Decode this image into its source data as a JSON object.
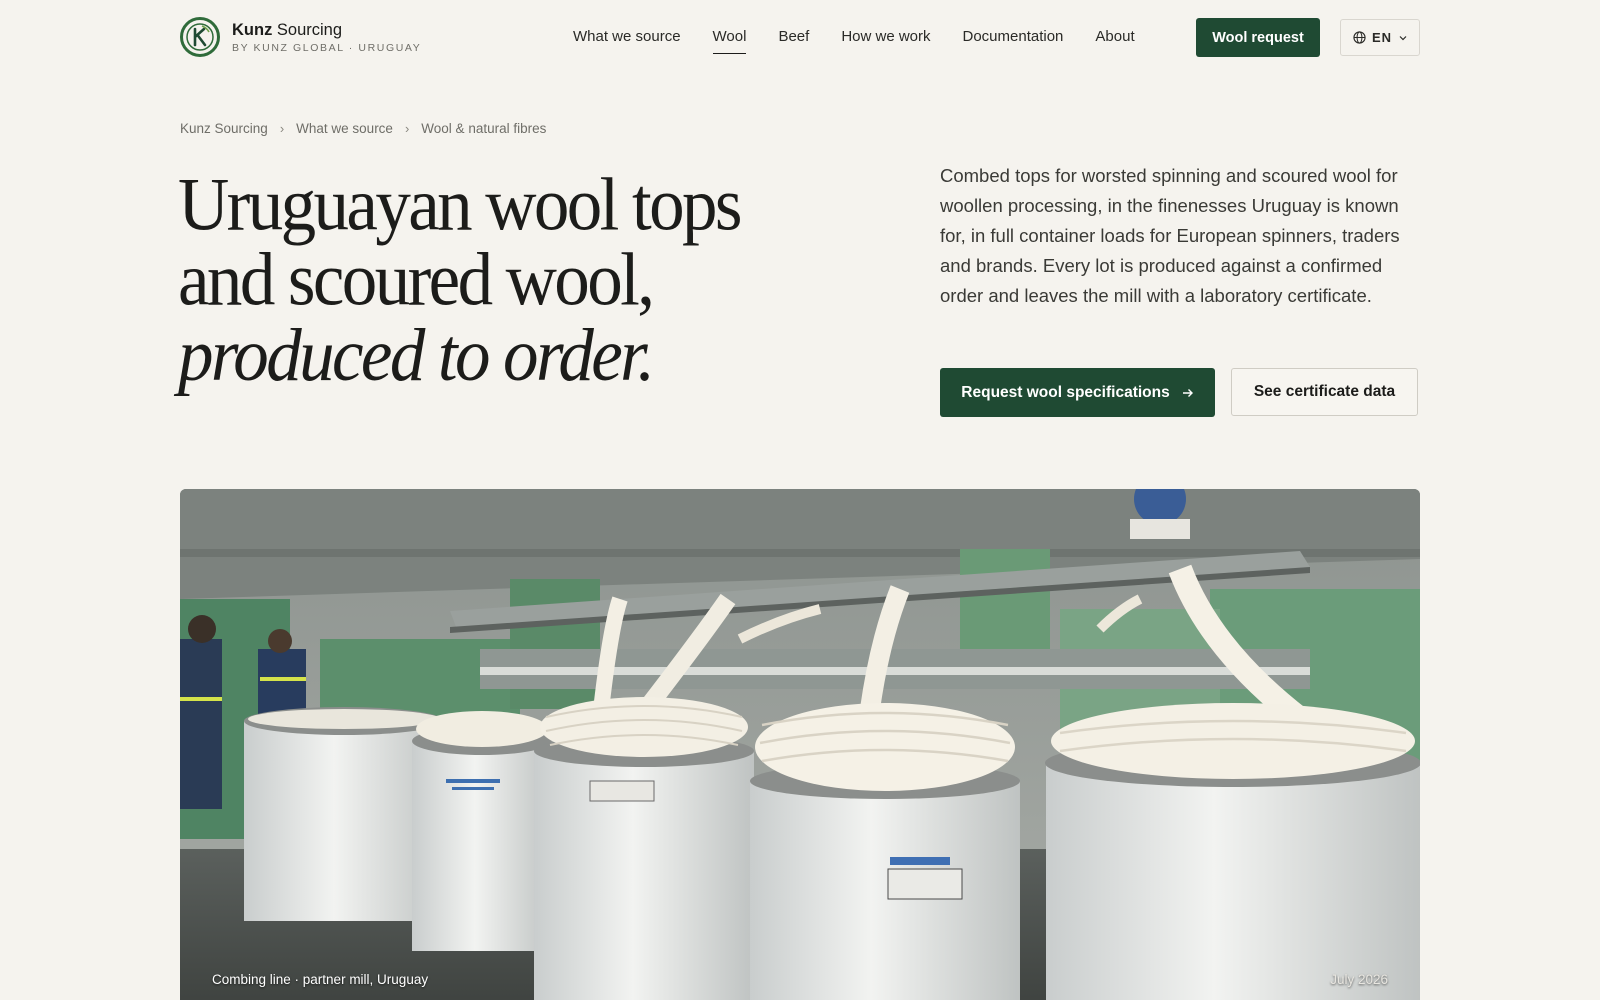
{
  "brand": {
    "name_bold": "Kunz",
    "name_rest": " Sourcing",
    "subtitle": "BY KUNZ GLOBAL · URUGUAY"
  },
  "nav": {
    "items": [
      {
        "label": "What we source",
        "active": false
      },
      {
        "label": "Wool",
        "active": true
      },
      {
        "label": "Beef",
        "active": false
      },
      {
        "label": "How we work",
        "active": false
      },
      {
        "label": "Documentation",
        "active": false
      },
      {
        "label": "About",
        "active": false
      }
    ],
    "cta_label": "Wool request",
    "language": "EN"
  },
  "breadcrumb": [
    "Kunz Sourcing",
    "What we source",
    "Wool & natural fibres"
  ],
  "hero": {
    "title_line1": "Uruguayan wool tops",
    "title_line2": "and scoured wool,",
    "title_line3": "produced to order.",
    "description": "Combed tops for worsted spinning and scoured wool for woollen processing, in the finenesses Uruguay is known for, in full container loads for European spinners, traders and brands. Every lot is produced against a confirmed order and leaves the mill with a laboratory certificate.",
    "primary_button": "Request wool specifications",
    "secondary_button": "See certificate data"
  },
  "photo": {
    "caption": "Combing line · partner mill, Uruguay",
    "date": "July 2026"
  },
  "colors": {
    "background": "#f5f3ee",
    "accent": "#1f4a33",
    "logo_green": "#2f6b3a"
  }
}
